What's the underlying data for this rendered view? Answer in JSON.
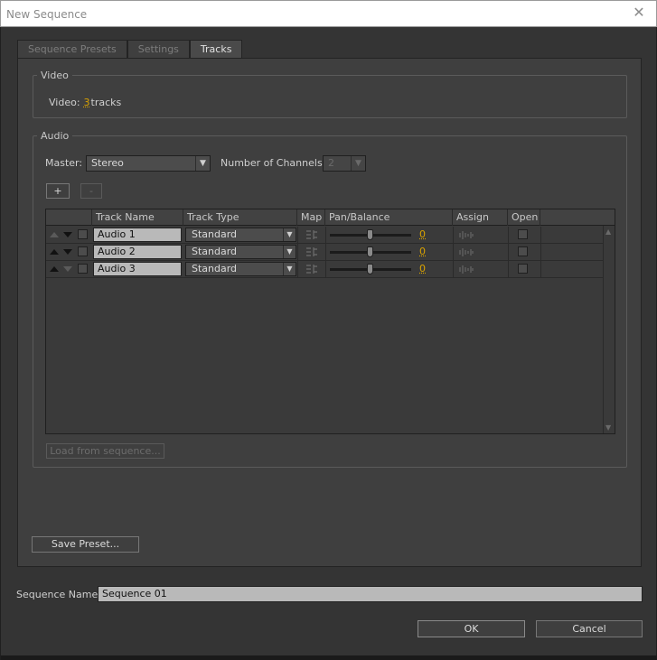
{
  "window": {
    "title": "New Sequence",
    "close_glyph": "✕"
  },
  "tabs": [
    {
      "label": "Sequence Presets",
      "active": false
    },
    {
      "label": "Settings",
      "active": false
    },
    {
      "label": "Tracks",
      "active": true
    }
  ],
  "video": {
    "legend": "Video",
    "label": "Video:",
    "count": "3",
    "unit": "tracks"
  },
  "audio": {
    "legend": "Audio",
    "master_label": "Master:",
    "master_value": "Stereo",
    "channels_label": "Number of Channels:",
    "channels_value": "2",
    "add_label": "+",
    "remove_label": "-",
    "columns": [
      "Track Name",
      "Track Type",
      "Map",
      "Pan/Balance",
      "Assign",
      "Open"
    ],
    "tracks": [
      {
        "name": "Audio 1",
        "type": "Standard",
        "pan": "0",
        "up_enabled": false,
        "down_enabled": true
      },
      {
        "name": "Audio 2",
        "type": "Standard",
        "pan": "0",
        "up_enabled": true,
        "down_enabled": true
      },
      {
        "name": "Audio 3",
        "type": "Standard",
        "pan": "0",
        "up_enabled": true,
        "down_enabled": false
      }
    ],
    "load_label": "Load from sequence..."
  },
  "save_preset_label": "Save Preset...",
  "sequence_name": {
    "label": "Sequence Name:",
    "value": "Sequence 01"
  },
  "buttons": {
    "ok": "OK",
    "cancel": "Cancel"
  },
  "colors": {
    "accent_value": "#d9a200",
    "panel": "#3f3f3f"
  },
  "icons": {
    "map": "map-icon",
    "assign": "assign-icon",
    "dropdown": "chevron-down-icon"
  }
}
